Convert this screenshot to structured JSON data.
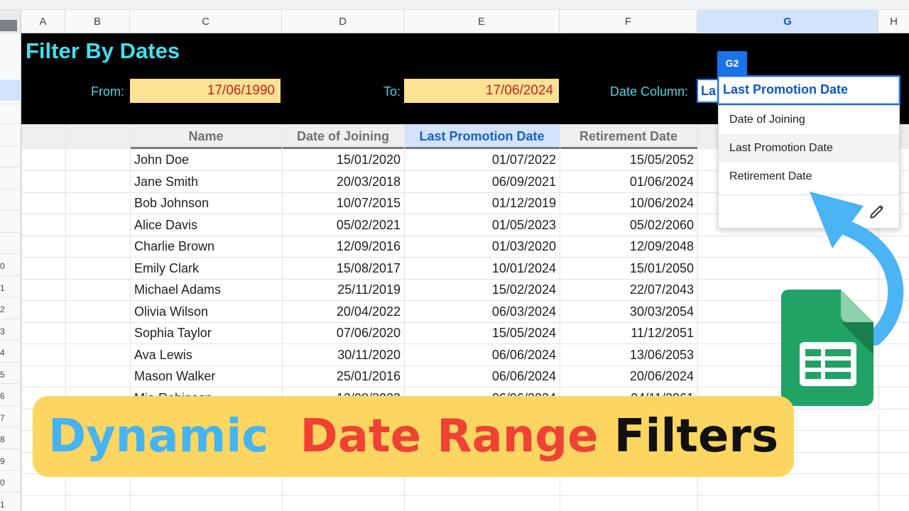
{
  "column_headers": [
    "A",
    "B",
    "C",
    "D",
    "E",
    "F",
    "G",
    "H"
  ],
  "selected_column": "G",
  "row_numbers": [
    "",
    "",
    "",
    "",
    "",
    "",
    "",
    "",
    "",
    "0",
    "1",
    "2",
    "3",
    "4",
    "5",
    "6",
    "7",
    "8",
    "9",
    "0",
    "1"
  ],
  "header_band": {
    "title": "Filter By Dates",
    "from_label": "From:",
    "from_value": "17/06/1990",
    "to_label": "To:",
    "to_value": "17/06/2024",
    "date_column_label": "Date Column:",
    "date_column_cell_text": "La"
  },
  "table": {
    "headers": [
      "Name",
      "Date of Joining",
      "Last Promotion Date",
      "Retirement Date"
    ],
    "active_header": "Last Promotion Date",
    "rows": [
      [
        "John Doe",
        "15/01/2020",
        "01/07/2022",
        "15/05/2052"
      ],
      [
        "Jane Smith",
        "20/03/2018",
        "06/09/2021",
        "01/06/2024"
      ],
      [
        "Bob Johnson",
        "10/07/2015",
        "01/12/2019",
        "10/06/2024"
      ],
      [
        "Alice Davis",
        "05/02/2021",
        "01/05/2023",
        "05/02/2060"
      ],
      [
        "Charlie Brown",
        "12/09/2016",
        "01/03/2020",
        "12/09/2048"
      ],
      [
        "Emily Clark",
        "15/08/2017",
        "10/01/2024",
        "15/01/2050"
      ],
      [
        "Michael Adams",
        "25/11/2019",
        "15/02/2024",
        "22/07/2043"
      ],
      [
        "Olivia Wilson",
        "20/04/2022",
        "06/03/2024",
        "30/03/2054"
      ],
      [
        "Sophia Taylor",
        "07/06/2020",
        "15/05/2024",
        "11/12/2051"
      ],
      [
        "Ava Lewis",
        "30/11/2020",
        "06/06/2024",
        "13/06/2053"
      ],
      [
        "Mason Walker",
        "25/01/2016",
        "06/06/2024",
        "20/06/2024"
      ],
      [
        "Mia Robinson",
        "12/08/2023",
        "06/06/2024",
        "04/11/2061"
      ]
    ]
  },
  "dropdown": {
    "cell_ref": "G2",
    "selected": "Last Promotion Date",
    "options": [
      "Date of Joining",
      "Last Promotion Date",
      "Retirement Date"
    ],
    "hovered": "Last Promotion Date"
  },
  "icons": {
    "pencil": "pencil-icon",
    "sheets_logo": "google-sheets-logo-icon",
    "arrow": "curved-arrow-icon"
  },
  "banner": {
    "word1": "Dynamic",
    "word2": "Date Range",
    "word3": "Filters"
  },
  "colors": {
    "band_bg": "#000000",
    "title": "#3fe0f0",
    "date_fill": "#fde293",
    "date_text": "#c5221f",
    "selection_blue": "#1a73e8",
    "banner_bg": "#fdd561",
    "banner_word1": "#46b3f2",
    "banner_word2": "#ef4134",
    "banner_word3": "#111111"
  }
}
